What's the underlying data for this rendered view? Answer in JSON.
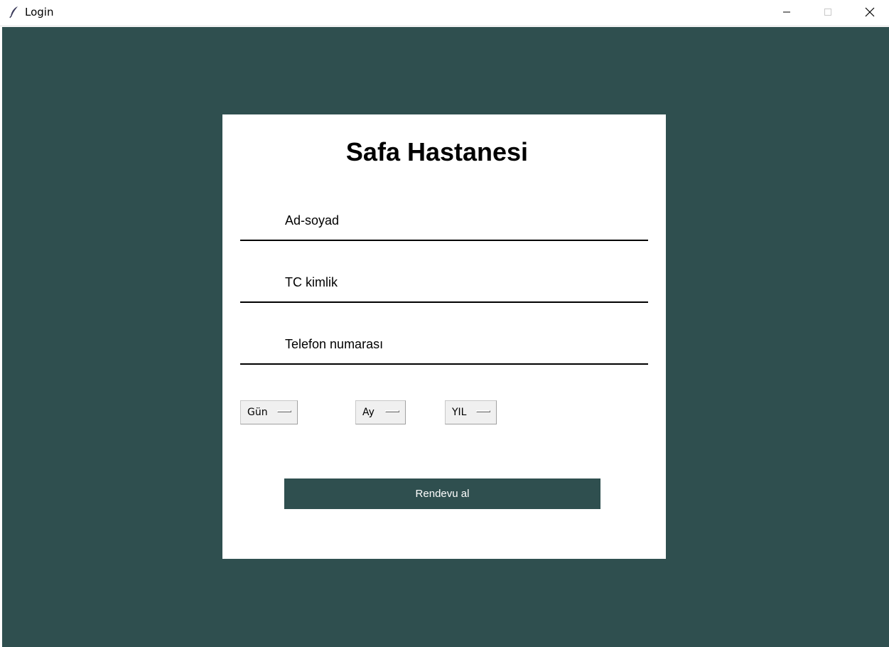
{
  "window": {
    "title": "Login",
    "icon": "feather-icon"
  },
  "form": {
    "heading": "Safa Hastanesi",
    "fields": [
      {
        "label": "Ad-soyad"
      },
      {
        "label": "TC kimlik"
      },
      {
        "label": "Telefon numarası"
      }
    ],
    "dropdowns": [
      {
        "selected": "Gün"
      },
      {
        "selected": "Ay"
      },
      {
        "selected": "YIL"
      }
    ],
    "submit_label": "Rendevu al"
  },
  "colors": {
    "background": "#2f4f4f",
    "card": "#ffffff",
    "button": "#2f4f4f",
    "button_text": "#ffffff"
  }
}
